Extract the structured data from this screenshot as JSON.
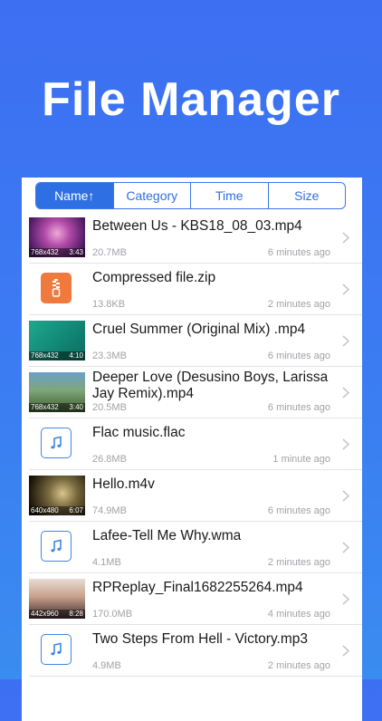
{
  "headline": "File Manager",
  "sort_tabs": [
    {
      "label": "Name↑",
      "active": true
    },
    {
      "label": "Category",
      "active": false
    },
    {
      "label": "Time",
      "active": false
    },
    {
      "label": "Size",
      "active": false
    }
  ],
  "files": [
    {
      "name": "Between Us - KBS18_08_03.mp4",
      "size": "20.7MB",
      "time": "6 minutes ago",
      "kind": "video",
      "resolution": "768x432",
      "duration": "3:43"
    },
    {
      "name": "Compressed file.zip",
      "size": "13.8KB",
      "time": "2 minutes ago",
      "kind": "zip"
    },
    {
      "name": "Cruel Summer (Original Mix) .mp4",
      "size": "23.3MB",
      "time": "6 minutes ago",
      "kind": "video",
      "resolution": "768x432",
      "duration": "4:10"
    },
    {
      "name": "Deeper Love (Desusino Boys, Larissa Jay Remix).mp4",
      "size": "20.5MB",
      "time": "6 minutes ago",
      "kind": "video",
      "resolution": "768x432",
      "duration": "3:40"
    },
    {
      "name": "Flac music.flac",
      "size": "26.8MB",
      "time": "1 minute ago",
      "kind": "audio"
    },
    {
      "name": "Hello.m4v",
      "size": "74.9MB",
      "time": "6 minutes ago",
      "kind": "video",
      "resolution": "640x480",
      "duration": "6:07"
    },
    {
      "name": "Lafee-Tell Me Why.wma",
      "size": "4.1MB",
      "time": "2 minutes ago",
      "kind": "audio"
    },
    {
      "name": "RPReplay_Final1682255264.mp4",
      "size": "170.0MB",
      "time": "4 minutes ago",
      "kind": "video",
      "resolution": "442x960",
      "duration": "8:28"
    },
    {
      "name": "Two Steps From Hell - Victory.mp3",
      "size": "4.9MB",
      "time": "2 minutes ago",
      "kind": "audio"
    }
  ],
  "colors": {
    "accent": "#2f6fe4",
    "background": "#3d72f1",
    "zip": "#f07a3e"
  },
  "icons": {
    "audio": "music-note-icon",
    "zip": "zip-icon",
    "row": "chevron-right-icon"
  }
}
